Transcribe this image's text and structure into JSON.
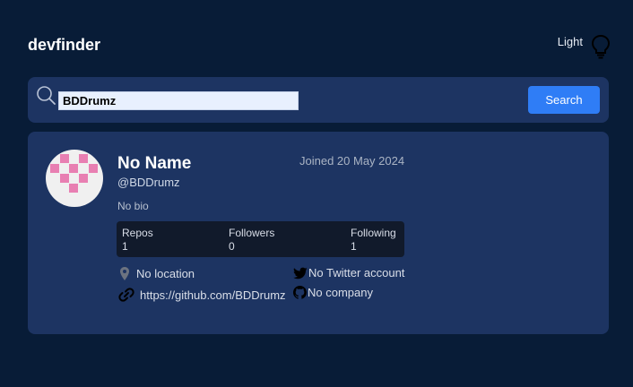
{
  "header": {
    "logo": "devfinder",
    "theme_label": "Light",
    "theme_icon": "lightbulb-icon"
  },
  "search": {
    "icon": "search-icon",
    "value": "BDDrumz",
    "button_label": "Search"
  },
  "profile": {
    "avatar": "identicon-avatar",
    "name": "No Name",
    "login": "@BDDrumz",
    "joined": "Joined 20 May 2024",
    "bio": "No bio",
    "stats": {
      "repos_label": "Repos",
      "repos_value": "1",
      "followers_label": "Followers",
      "followers_value": "0",
      "following_label": "Following",
      "following_value": "1"
    },
    "links": {
      "location": "No location",
      "website": "https://github.com/BDDrumz",
      "twitter": "No Twitter account",
      "company": "No company"
    }
  },
  "colors": {
    "background": "#081c37",
    "panel": "#1d3462",
    "accent": "#2f7df6",
    "stats_bg": "#111a2b",
    "identicon": "#e87fb2"
  }
}
